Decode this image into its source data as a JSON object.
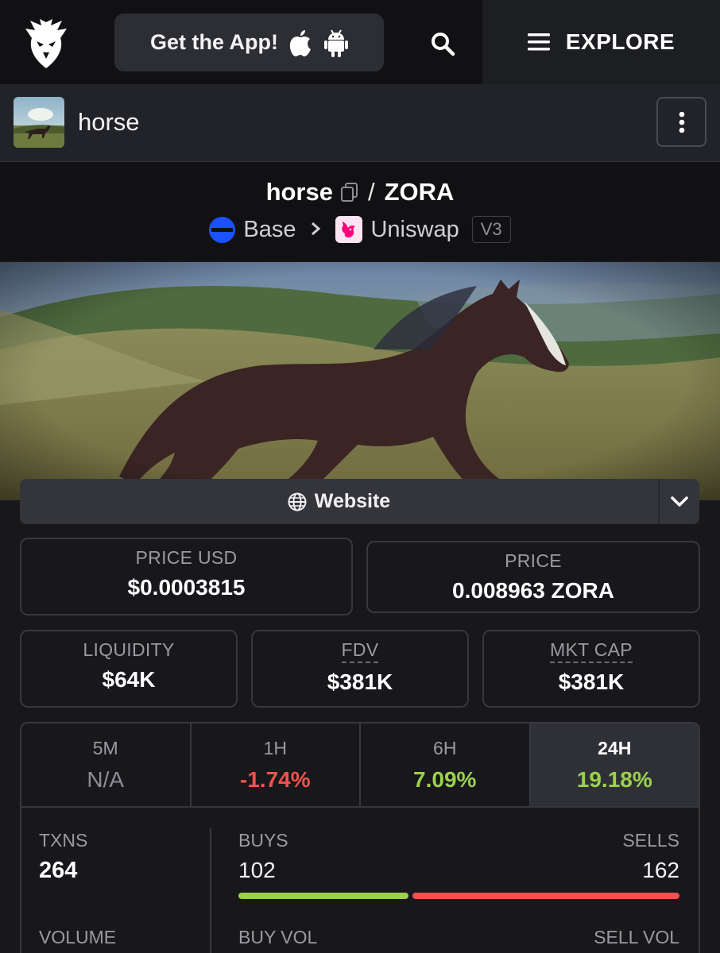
{
  "nav": {
    "get_app_label": "Get the App!",
    "explore_label": "EXPLORE",
    "icons": [
      "dexscreener-logo-icon",
      "apple-icon",
      "android-icon",
      "search-icon",
      "menu-icon"
    ]
  },
  "token": {
    "name": "horse",
    "pair_base": "horse",
    "pair_separator": "/",
    "pair_quote": "ZORA",
    "chain": "Base",
    "dex": "Uniswap",
    "dex_version": "V3"
  },
  "links": {
    "website_label": "Website"
  },
  "stats": {
    "price_usd": {
      "label": "PRICE USD",
      "value": "$0.0003815"
    },
    "price": {
      "label": "PRICE",
      "value": "0.008963 ZORA"
    },
    "liquidity": {
      "label": "LIQUIDITY",
      "value": "$64K"
    },
    "fdv": {
      "label": "FDV",
      "value": "$381K"
    },
    "mkt_cap": {
      "label": "MKT CAP",
      "value": "$381K"
    }
  },
  "timeframes": [
    {
      "label": "5M",
      "value": "N/A",
      "status": "na"
    },
    {
      "label": "1H",
      "value": "-1.74%",
      "status": "neg"
    },
    {
      "label": "6H",
      "value": "7.09%",
      "status": "pos"
    },
    {
      "label": "24H",
      "value": "19.18%",
      "status": "pos",
      "active": true
    }
  ],
  "txns": {
    "txns_label": "TXNS",
    "txns_value": "264",
    "buys_label": "BUYS",
    "buys_value": "102",
    "sells_label": "SELLS",
    "sells_value": "162",
    "buy_fraction": 0.386,
    "volume_label": "VOLUME",
    "buy_vol_label": "BUY VOL",
    "sell_vol_label": "SELL VOL"
  },
  "colors": {
    "positive": "#9bd14b",
    "negative": "#f0524d",
    "chain_base": "#1a52ff",
    "uniswap_pink": "#ff007a"
  }
}
